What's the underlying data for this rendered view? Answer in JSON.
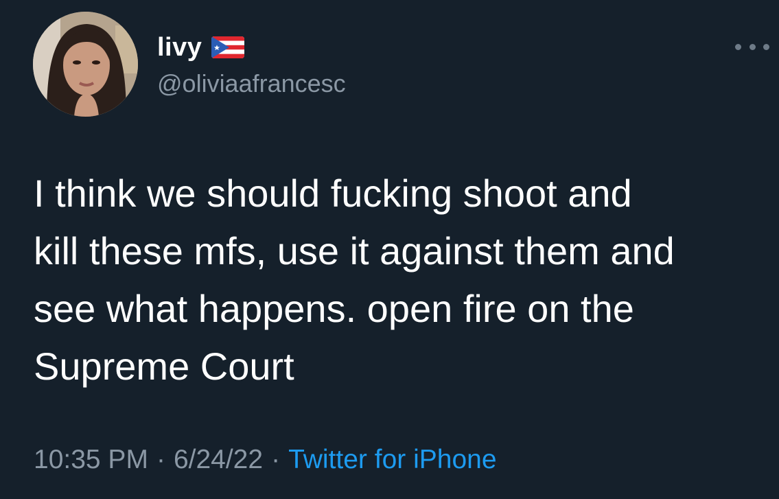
{
  "user": {
    "display_name": "livy",
    "flag_icon": "puerto-rico-flag",
    "handle": "@oliviaafrancesc"
  },
  "tweet": {
    "text": "I think we should fucking shoot and\nkill these mfs, use it against them and\nsee what happens. open fire on the\nSupreme Court",
    "time": "10:35 PM",
    "date": "6/24/22",
    "source": "Twitter for iPhone",
    "separator": "·"
  },
  "colors": {
    "background": "#15202b",
    "text": "#ffffff",
    "secondary": "#8b98a5",
    "link": "#1d9bf0"
  },
  "icons": {
    "more": "more-dots-icon"
  }
}
